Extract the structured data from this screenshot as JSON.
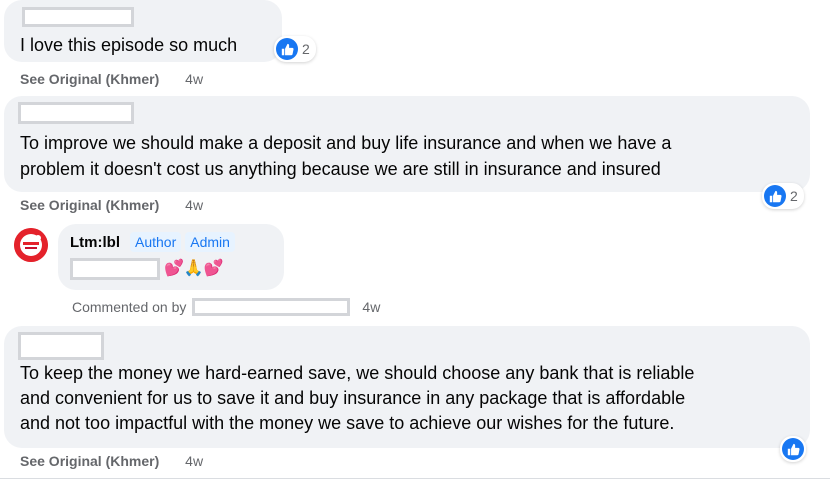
{
  "comments": [
    {
      "text": "I love this episode so much",
      "reaction_count": "2",
      "see_original": "See Original (Khmer)",
      "time": "4w"
    },
    {
      "text_line1": "To improve we should make a deposit and buy life insurance and when we have a",
      "text_line2": "problem it doesn't cost us anything because we are still in insurance and insured",
      "reaction_count": "2",
      "see_original": "See Original (Khmer)",
      "time": "4w"
    },
    {
      "author": "Ltm:lbl",
      "badge_author": "Author",
      "badge_admin": "Admin",
      "emoji": "💕🙏💕",
      "commented_on_by": "Commented on by",
      "time": "4w"
    },
    {
      "text_line1": "To keep the money we hard-earned save, we should choose any bank that is reliable",
      "text_line2": "and convenient for us to save it and buy insurance in any package that is affordable",
      "text_line3": "and not too impactful with the money we save to achieve our wishes for the future.",
      "see_original": "See Original (Khmer)",
      "time": "4w"
    }
  ],
  "colors": {
    "bubble": "#f0f2f5",
    "like_blue": "#1877f2",
    "meta_gray": "#65676b",
    "badge_bg": "#e7f3ff",
    "avatar_red": "#e4222b"
  },
  "icons": {
    "reaction": "like-thumbs-up-icon",
    "avatar": "page-logo-avatar"
  }
}
